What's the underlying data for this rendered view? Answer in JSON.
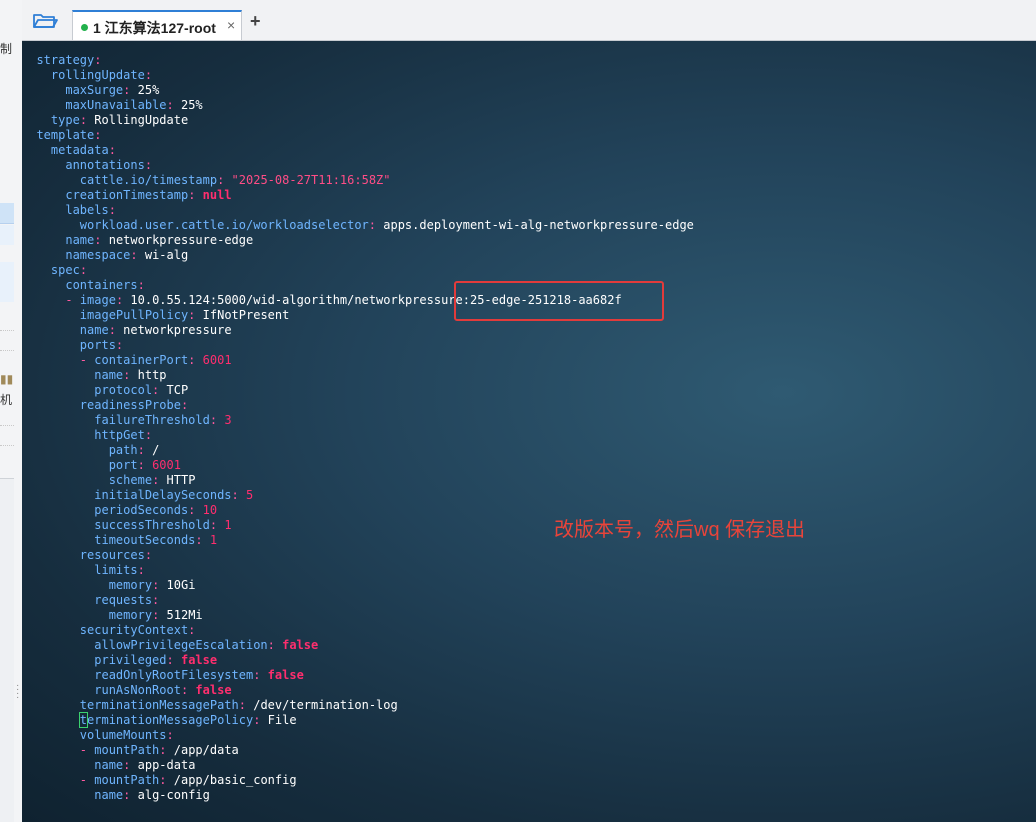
{
  "app": {
    "tab_title": "1 江东算法127-root",
    "tab_close": "×",
    "add_tab": "+"
  },
  "sidebar": {
    "text_top": "制",
    "text_mid": "机"
  },
  "annotation": {
    "note": "改版本号，然后wq 保存退出",
    "color": "#e8443a"
  },
  "colors": {
    "key": "#6fb5ff",
    "value": "#ffffff",
    "special_value": "#ff2e6e",
    "terminal_bg": "#1b364a",
    "highlight_border": "#e23b3b"
  },
  "terminal": {
    "lines": [
      {
        "indent": "  ",
        "dash": "",
        "key": "strategy",
        "value": "",
        "vclass": "v"
      },
      {
        "indent": "    ",
        "dash": "",
        "key": "rollingUpdate",
        "value": "",
        "vclass": "v"
      },
      {
        "indent": "      ",
        "dash": "",
        "key": "maxSurge",
        "value": "25%",
        "vclass": "v"
      },
      {
        "indent": "      ",
        "dash": "",
        "key": "maxUnavailable",
        "value": "25%",
        "vclass": "v"
      },
      {
        "indent": "    ",
        "dash": "",
        "key": "type",
        "value": "RollingUpdate",
        "vclass": "v"
      },
      {
        "indent": "  ",
        "dash": "",
        "key": "template",
        "value": "",
        "vclass": "v"
      },
      {
        "indent": "    ",
        "dash": "",
        "key": "metadata",
        "value": "",
        "vclass": "v"
      },
      {
        "indent": "      ",
        "dash": "",
        "key": "annotations",
        "value": "",
        "vclass": "v"
      },
      {
        "indent": "        ",
        "dash": "",
        "key": "cattle.io/timestamp",
        "value": "\"2025-08-27T11:16:58Z\"",
        "vclass": "s"
      },
      {
        "indent": "      ",
        "dash": "",
        "key": "creationTimestamp",
        "value": "null",
        "vclass": "b"
      },
      {
        "indent": "      ",
        "dash": "",
        "key": "labels",
        "value": "",
        "vclass": "v"
      },
      {
        "indent": "        ",
        "dash": "",
        "key": "workload.user.cattle.io/workloadselector",
        "value": "apps.deployment-wi-alg-networkpressure-edge",
        "vclass": "v"
      },
      {
        "indent": "      ",
        "dash": "",
        "key": "name",
        "value": "networkpressure-edge",
        "vclass": "v"
      },
      {
        "indent": "      ",
        "dash": "",
        "key": "namespace",
        "value": "wi-alg",
        "vclass": "v"
      },
      {
        "indent": "    ",
        "dash": "",
        "key": "spec",
        "value": "",
        "vclass": "v"
      },
      {
        "indent": "      ",
        "dash": "",
        "key": "containers",
        "value": "",
        "vclass": "v"
      },
      {
        "indent": "      ",
        "dash": "- ",
        "key": "image",
        "value": "10.0.55.124:5000/wid-algorithm/networkpressure:25-edge-251218-aa682f",
        "vclass": "v"
      },
      {
        "indent": "        ",
        "dash": "",
        "key": "imagePullPolicy",
        "value": "IfNotPresent",
        "vclass": "v"
      },
      {
        "indent": "        ",
        "dash": "",
        "key": "name",
        "value": "networkpressure",
        "vclass": "v"
      },
      {
        "indent": "        ",
        "dash": "",
        "key": "ports",
        "value": "",
        "vclass": "v"
      },
      {
        "indent": "        ",
        "dash": "- ",
        "key": "containerPort",
        "value": "6001",
        "vclass": "n"
      },
      {
        "indent": "          ",
        "dash": "",
        "key": "name",
        "value": "http",
        "vclass": "v"
      },
      {
        "indent": "          ",
        "dash": "",
        "key": "protocol",
        "value": "TCP",
        "vclass": "v"
      },
      {
        "indent": "        ",
        "dash": "",
        "key": "readinessProbe",
        "value": "",
        "vclass": "v"
      },
      {
        "indent": "          ",
        "dash": "",
        "key": "failureThreshold",
        "value": "3",
        "vclass": "n"
      },
      {
        "indent": "          ",
        "dash": "",
        "key": "httpGet",
        "value": "",
        "vclass": "v"
      },
      {
        "indent": "            ",
        "dash": "",
        "key": "path",
        "value": "/",
        "vclass": "v"
      },
      {
        "indent": "            ",
        "dash": "",
        "key": "port",
        "value": "6001",
        "vclass": "n"
      },
      {
        "indent": "            ",
        "dash": "",
        "key": "scheme",
        "value": "HTTP",
        "vclass": "v"
      },
      {
        "indent": "          ",
        "dash": "",
        "key": "initialDelaySeconds",
        "value": "5",
        "vclass": "n"
      },
      {
        "indent": "          ",
        "dash": "",
        "key": "periodSeconds",
        "value": "10",
        "vclass": "n"
      },
      {
        "indent": "          ",
        "dash": "",
        "key": "successThreshold",
        "value": "1",
        "vclass": "n"
      },
      {
        "indent": "          ",
        "dash": "",
        "key": "timeoutSeconds",
        "value": "1",
        "vclass": "n"
      },
      {
        "indent": "        ",
        "dash": "",
        "key": "resources",
        "value": "",
        "vclass": "v"
      },
      {
        "indent": "          ",
        "dash": "",
        "key": "limits",
        "value": "",
        "vclass": "v"
      },
      {
        "indent": "            ",
        "dash": "",
        "key": "memory",
        "value": "10Gi",
        "vclass": "v"
      },
      {
        "indent": "          ",
        "dash": "",
        "key": "requests",
        "value": "",
        "vclass": "v"
      },
      {
        "indent": "            ",
        "dash": "",
        "key": "memory",
        "value": "512Mi",
        "vclass": "v"
      },
      {
        "indent": "        ",
        "dash": "",
        "key": "securityContext",
        "value": "",
        "vclass": "v"
      },
      {
        "indent": "          ",
        "dash": "",
        "key": "allowPrivilegeEscalation",
        "value": "false",
        "vclass": "b"
      },
      {
        "indent": "          ",
        "dash": "",
        "key": "privileged",
        "value": "false",
        "vclass": "b"
      },
      {
        "indent": "          ",
        "dash": "",
        "key": "readOnlyRootFilesystem",
        "value": "false",
        "vclass": "b"
      },
      {
        "indent": "          ",
        "dash": "",
        "key": "runAsNonRoot",
        "value": "false",
        "vclass": "b"
      },
      {
        "indent": "        ",
        "dash": "",
        "key": "terminationMessagePath",
        "value": "/dev/termination-log",
        "vclass": "v"
      },
      {
        "indent": "        ",
        "dash": "",
        "key": "terminationMessagePolicy",
        "value": "File",
        "vclass": "v",
        "cursor": true
      },
      {
        "indent": "        ",
        "dash": "",
        "key": "volumeMounts",
        "value": "",
        "vclass": "v"
      },
      {
        "indent": "        ",
        "dash": "- ",
        "key": "mountPath",
        "value": "/app/data",
        "vclass": "v"
      },
      {
        "indent": "          ",
        "dash": "",
        "key": "name",
        "value": "app-data",
        "vclass": "v"
      },
      {
        "indent": "        ",
        "dash": "- ",
        "key": "mountPath",
        "value": "/app/basic_config",
        "vclass": "v"
      },
      {
        "indent": "          ",
        "dash": "",
        "key": "name",
        "value": "alg-config",
        "vclass": "v"
      }
    ]
  }
}
